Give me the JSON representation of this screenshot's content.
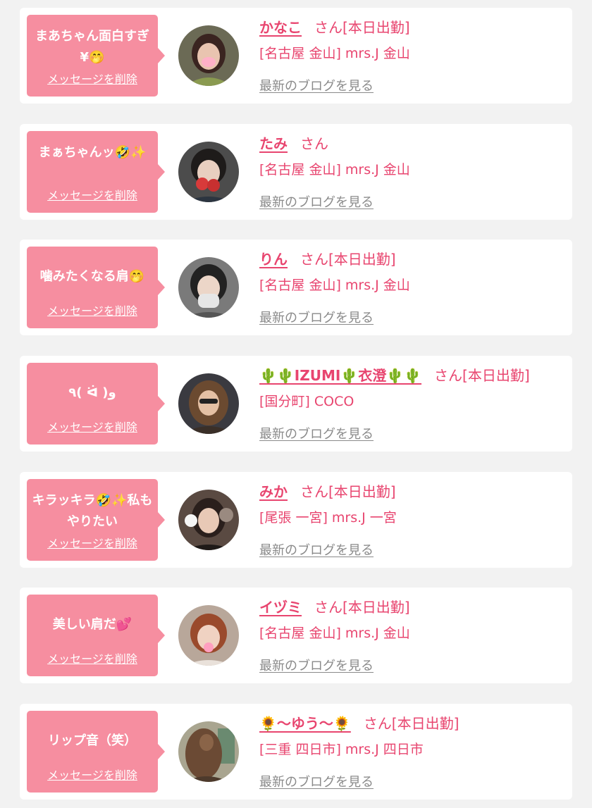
{
  "colors": {
    "accent": "#e8456f",
    "bubble": "#f68ea0",
    "background": "#f2f2f2",
    "link_gray": "#8a8a8a"
  },
  "delete_label": "メッセージを削除",
  "blog_label": "最新のブログを見る",
  "items": [
    {
      "message": "まあちゃん面白すぎ¥🤭",
      "name": "かなこ",
      "suffix": "さん[本日出勤]",
      "shop": "[名古屋 金山] mrs.J 金山"
    },
    {
      "message": "まぁちゃんッ🤣✨",
      "name": "たみ",
      "suffix": "さん",
      "shop": "[名古屋 金山] mrs.J 金山"
    },
    {
      "message": "噛みたくなる肩🤭",
      "name": "りん",
      "suffix": "さん[本日出勤]",
      "shop": "[名古屋 金山] mrs.J 金山"
    },
    {
      "message": "٩( ᐛ )و",
      "name": "🌵🌵IZUMI🌵衣澄🌵🌵",
      "suffix": "さん[本日出勤]",
      "shop": "[国分町] COCO"
    },
    {
      "message": "キラッキラ🤣✨私もやりたい",
      "name": "みか",
      "suffix": "さん[本日出勤]",
      "shop": "[尾張 一宮] mrs.J 一宮"
    },
    {
      "message": "美しい肩だ💕",
      "name": "イヅミ",
      "suffix": "さん[本日出勤]",
      "shop": "[名古屋 金山] mrs.J 金山"
    },
    {
      "message": "リップ音（笑）",
      "name": "🌻〜ゆう〜🌻",
      "suffix": "さん[本日出勤]",
      "shop": "[三重 四日市] mrs.J 四日市"
    }
  ]
}
